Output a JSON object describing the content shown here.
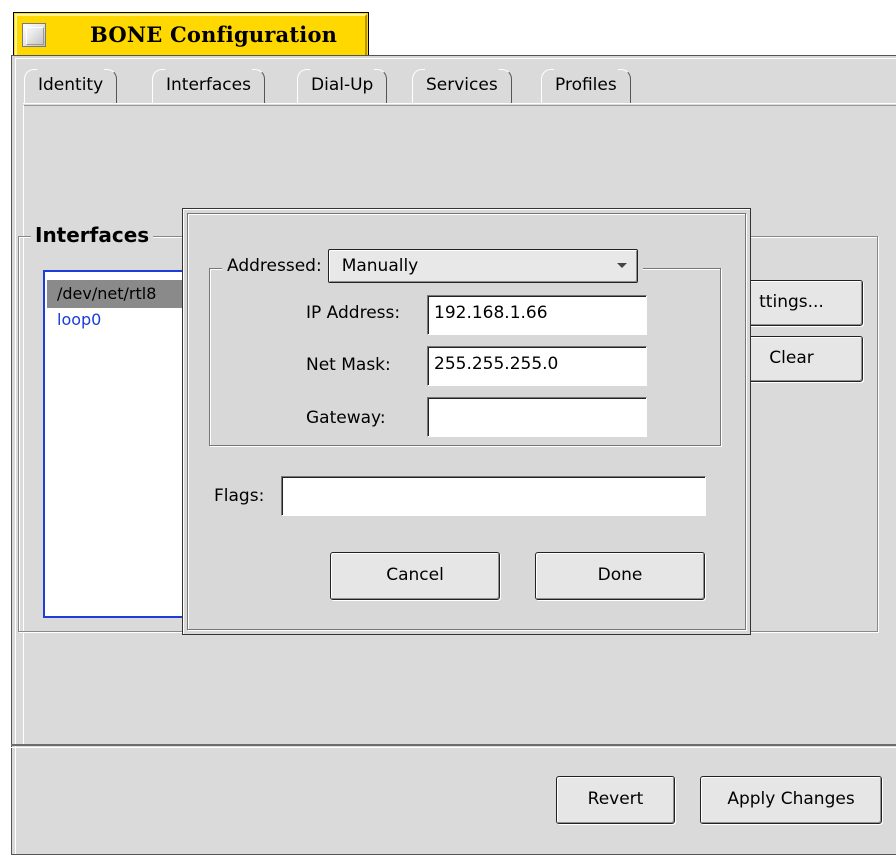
{
  "window": {
    "title": "BONE Configuration",
    "accent_color": "#ffd800"
  },
  "tabs": [
    {
      "label": "Identity",
      "active": false
    },
    {
      "label": "Interfaces",
      "active": true
    },
    {
      "label": "Dial-Up",
      "active": false
    },
    {
      "label": "Services",
      "active": false
    },
    {
      "label": "Profiles",
      "active": false
    }
  ],
  "interfaces": {
    "box_label": "Interfaces",
    "items": [
      {
        "label": "/dev/net/rtl8",
        "selected": true
      },
      {
        "label": "loop0",
        "selected": false
      }
    ],
    "settings_label": "ttings...",
    "clear_label": "Clear"
  },
  "dialog": {
    "addressed_label": "Addressed:",
    "addressed_value": "Manually",
    "ip_label": "IP Address:",
    "ip_value": "192.168.1.66",
    "netmask_label": "Net Mask:",
    "netmask_value": "255.255.255.0",
    "gateway_label": "Gateway:",
    "gateway_value": "",
    "flags_label": "Flags:",
    "flags_value": "",
    "cancel_label": "Cancel",
    "done_label": "Done"
  },
  "footer": {
    "revert_label": "Revert",
    "apply_label": "Apply Changes"
  }
}
